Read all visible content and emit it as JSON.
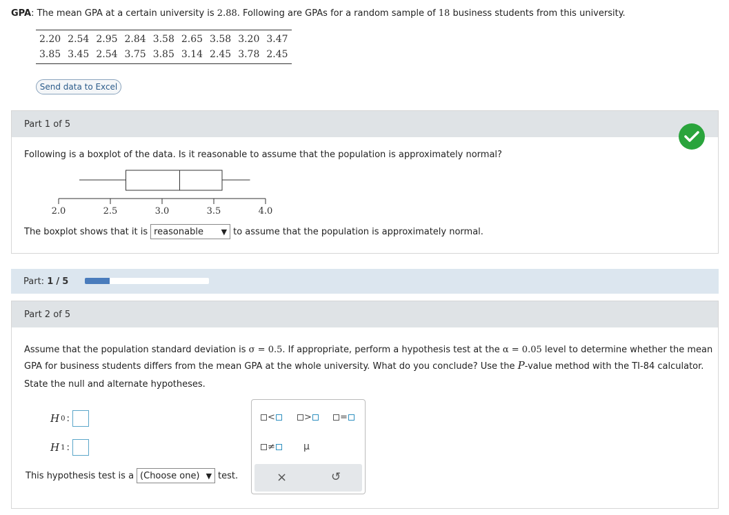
{
  "intro": {
    "label": "GPA",
    "text_before_mean": ": The mean GPA at a certain university is ",
    "mean": "2.88",
    "text_middle": ". Following are GPAs for a random sample of ",
    "sample_size": "18",
    "text_end": " business students from this university."
  },
  "gpa_table": [
    [
      "2.20",
      "2.54",
      "2.95",
      "2.84",
      "3.58",
      "2.65",
      "3.58",
      "3.20",
      "3.47"
    ],
    [
      "3.85",
      "3.45",
      "2.54",
      "3.75",
      "3.85",
      "3.14",
      "2.45",
      "3.78",
      "2.45"
    ]
  ],
  "send_excel_label": "Send data to Excel",
  "part1": {
    "header": "Part 1 of 5",
    "question": "Following is a boxplot of the data. Is it reasonable to assume that the population is approximately normal?",
    "boxplot": {
      "min": 2.2,
      "q1": 2.65,
      "median": 3.17,
      "q3": 3.58,
      "max": 3.85,
      "axis_ticks": [
        "2.0",
        "2.5",
        "3.0",
        "3.5",
        "4.0"
      ],
      "axis_range": [
        2.0,
        4.0
      ]
    },
    "answer_prefix": "The boxplot shows that it is",
    "answer_value": "reasonable",
    "answer_suffix": "to assume that the population is approximately normal.",
    "status": "correct",
    "status_color": "#2aa43c"
  },
  "progress": {
    "label": "Part:",
    "current": "1",
    "separator": "/",
    "total": "5",
    "fraction": 0.2,
    "fill_color": "#4a7cbc"
  },
  "part2": {
    "header": "Part 2 of 5",
    "q_line1_a": "Assume that the population standard deviation is ",
    "sigma_expr": "σ = 0.5",
    "q_line1_b": ". If appropriate, perform a hypothesis test at the ",
    "alpha_expr": "α = 0.05",
    "q_line1_c": " level to determine whether the mean",
    "q_line2_a": "GPA for business students differs from the mean GPA at the whole university. What do you conclude? Use the ",
    "p_symbol": "P",
    "q_line2_b": "-value method with the TI-84 calculator.",
    "instruction": "State the null and alternate hypotheses.",
    "h0_label": "H",
    "h0_sub": "0",
    "h1_label": "H",
    "h1_sub": "1",
    "test_prefix": "This hypothesis test is a",
    "test_select": "(Choose one)",
    "test_suffix": "test."
  },
  "palette": {
    "ops": [
      "<",
      ">",
      "=",
      "≠"
    ],
    "mu": "μ",
    "clear": "×",
    "undo": "↺"
  }
}
